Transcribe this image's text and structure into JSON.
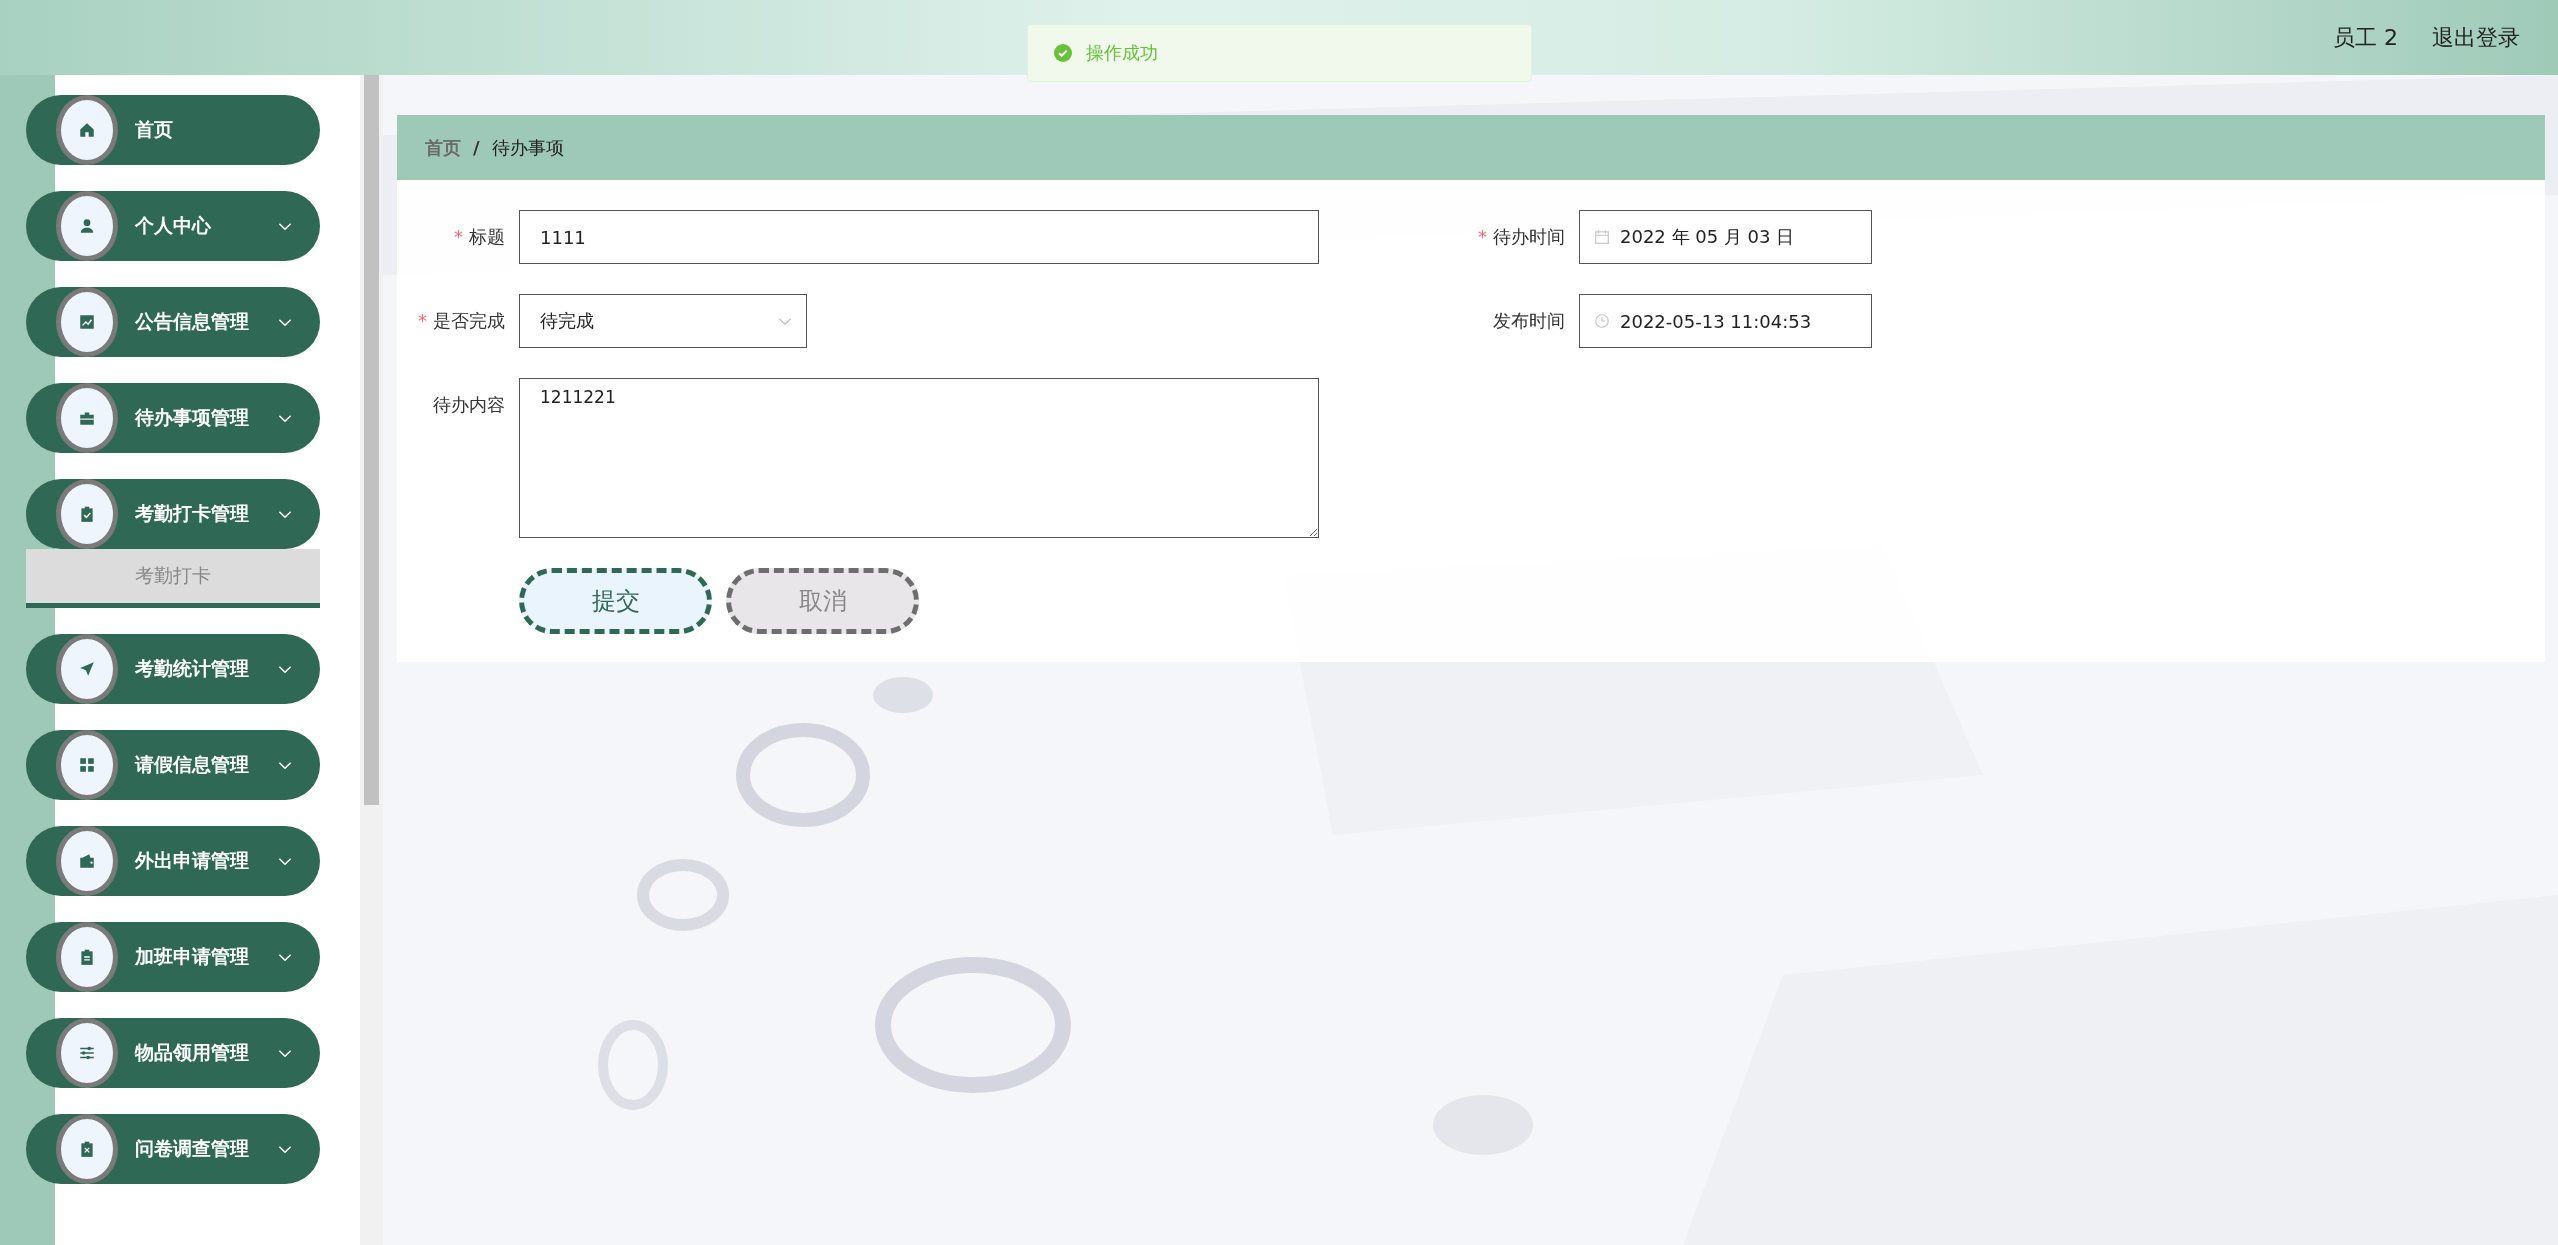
{
  "header": {
    "user": "员工 2",
    "logout": "退出登录"
  },
  "toast": {
    "kind": "success",
    "message": "操作成功"
  },
  "sidebar": {
    "items": [
      {
        "label": "首页",
        "has_submenu": false
      },
      {
        "label": "个人中心",
        "has_submenu": true,
        "expanded": false
      },
      {
        "label": "公告信息管理",
        "has_submenu": true,
        "expanded": false
      },
      {
        "label": "待办事项管理",
        "has_submenu": true,
        "expanded": false
      },
      {
        "label": "考勤打卡管理",
        "has_submenu": true,
        "expanded": true,
        "children": [
          {
            "label": "考勤打卡",
            "hovered": true
          }
        ]
      },
      {
        "label": "考勤统计管理",
        "has_submenu": true,
        "expanded": false
      },
      {
        "label": "请假信息管理",
        "has_submenu": true,
        "expanded": false
      },
      {
        "label": "外出申请管理",
        "has_submenu": true,
        "expanded": false
      },
      {
        "label": "加班申请管理",
        "has_submenu": true,
        "expanded": false
      },
      {
        "label": "物品领用管理",
        "has_submenu": true,
        "expanded": false
      },
      {
        "label": "问卷调查管理",
        "has_submenu": true,
        "expanded": false
      }
    ]
  },
  "breadcrumb": {
    "items": [
      "首页",
      "待办事项"
    ],
    "separator": "/"
  },
  "form": {
    "required_mark": "*",
    "rows": [
      [
        {
          "label": "标题",
          "required": true,
          "kind": "text",
          "value": "1111"
        },
        {
          "label": "待办时间",
          "required": true,
          "kind": "date",
          "value": "2022 年 05 月 03 日"
        }
      ],
      [
        {
          "label": "是否完成",
          "required": true,
          "kind": "select",
          "value": "待完成"
        },
        {
          "label": "发布时间",
          "required": false,
          "kind": "datetime",
          "value": "2022-05-13 11:04:53"
        }
      ],
      [
        {
          "label": "待办内容",
          "required": false,
          "kind": "textarea",
          "value": "1211221"
        }
      ]
    ],
    "buttons": [
      {
        "label": "提交",
        "kind": "primary"
      },
      {
        "label": "取消",
        "kind": "secondary"
      }
    ]
  }
}
